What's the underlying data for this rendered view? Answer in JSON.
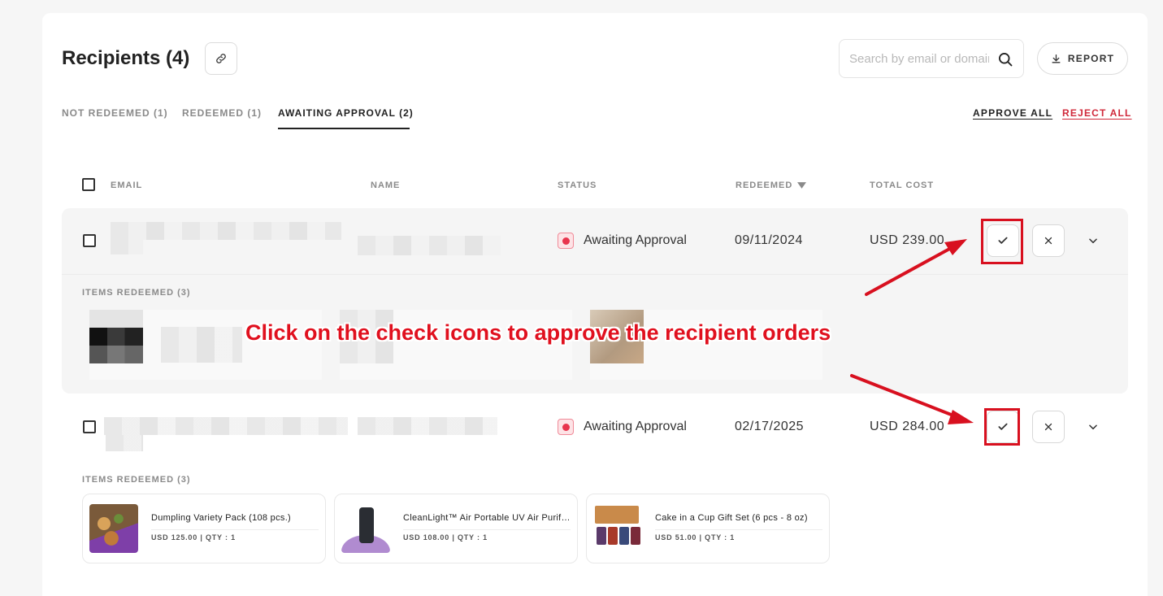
{
  "header": {
    "title": "Recipients (4)",
    "search_placeholder": "Search by email or domain",
    "report_label": "REPORT"
  },
  "tabs": [
    {
      "label": "NOT REDEEMED (1)",
      "active": false
    },
    {
      "label": "REDEEMED (1)",
      "active": false
    },
    {
      "label": "AWAITING APPROVAL (2)",
      "active": true
    }
  ],
  "bulk_actions": {
    "approve_all": "APPROVE ALL",
    "reject_all": "REJECT ALL"
  },
  "table": {
    "columns": {
      "email": "EMAIL",
      "name": "NAME",
      "status": "STATUS",
      "redeemed": "REDEEMED",
      "total_cost": "TOTAL COST"
    },
    "rows": [
      {
        "status": "Awaiting Approval",
        "redeemed": "09/11/2024",
        "total_cost": "USD 239.00",
        "items_label": "ITEMS REDEEMED (3)"
      },
      {
        "status": "Awaiting Approval",
        "redeemed": "02/17/2025",
        "total_cost": "USD 284.00",
        "items_label": "ITEMS REDEEMED (3)",
        "items": [
          {
            "name": "Dumpling Variety Pack (108 pcs.)",
            "meta": "USD 125.00 | QTY : 1"
          },
          {
            "name": "CleanLight™ Air Portable UV Air Purifier",
            "meta": "USD 108.00 | QTY : 1"
          },
          {
            "name": "Cake in a Cup Gift Set (6 pcs - 8 oz)",
            "meta": "USD 51.00 | QTY : 1"
          }
        ]
      }
    ]
  },
  "annotation": {
    "text": "Click on the check icons to approve the recipient orders",
    "color": "#e0101e"
  },
  "colors": {
    "accent_red": "#d0283a",
    "status_red": "#e8344d",
    "highlight_red": "#d8101f"
  }
}
